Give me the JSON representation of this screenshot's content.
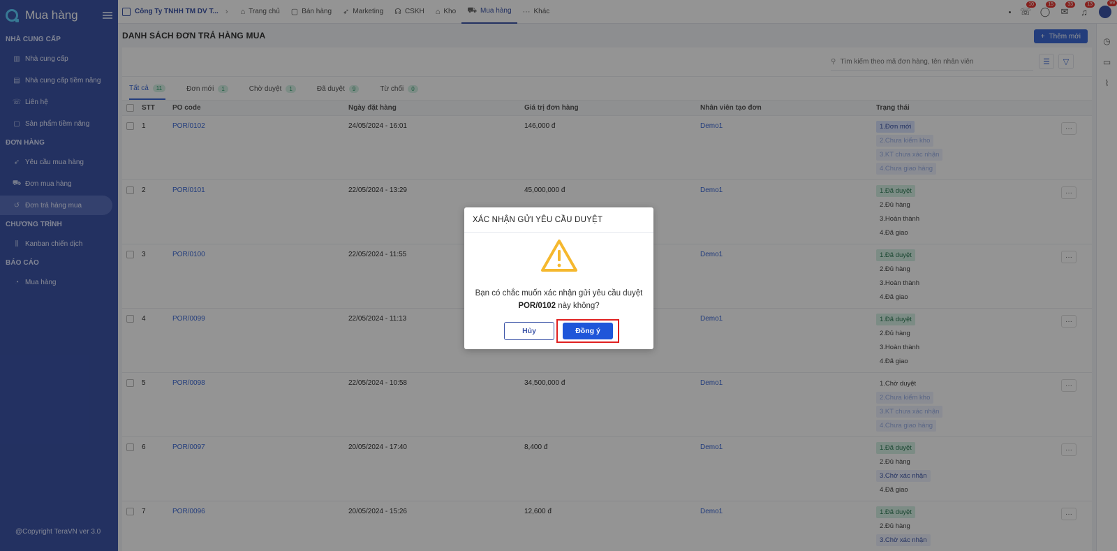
{
  "app": {
    "title": "Mua hàng",
    "copyright": "@Copyright TeraVN ver 3.0"
  },
  "sidebar": {
    "sections": [
      {
        "label": "NHÀ CUNG CẤP",
        "items": [
          {
            "label": "Nhà cung cấp",
            "icon": "building-icon"
          },
          {
            "label": "Nhà cung cấp tiềm năng",
            "icon": "buildings-icon"
          },
          {
            "label": "Liên hệ",
            "icon": "phone-icon"
          },
          {
            "label": "Sản phẩm tiềm năng",
            "icon": "box-icon"
          }
        ]
      },
      {
        "label": "ĐƠN HÀNG",
        "items": [
          {
            "label": "Yêu cầu mua hàng",
            "icon": "rocket-icon"
          },
          {
            "label": "Đơn mua hàng",
            "icon": "cart-icon"
          },
          {
            "label": "Đơn trả hàng mua",
            "icon": "return-icon",
            "active": true
          }
        ]
      },
      {
        "label": "CHƯƠNG TRÌNH",
        "items": [
          {
            "label": "Kanban chiến dịch",
            "icon": "kanban-icon"
          }
        ]
      },
      {
        "label": "BÁO CÁO",
        "items": [
          {
            "label": "Mua hàng",
            "icon": "chart-icon"
          }
        ]
      }
    ]
  },
  "topbar": {
    "company": "Công Ty TNHH TM DV T...",
    "tabs": [
      {
        "label": "Trang chủ",
        "icon": "home-icon"
      },
      {
        "label": "Bán hàng",
        "icon": "box-icon"
      },
      {
        "label": "Marketing",
        "icon": "rocket-icon"
      },
      {
        "label": "CSKH",
        "icon": "headset-icon"
      },
      {
        "label": "Kho",
        "icon": "warehouse-icon"
      },
      {
        "label": "Mua hàng",
        "icon": "cart-icon",
        "active": true
      },
      {
        "label": "Khác",
        "icon": "more-icon"
      }
    ],
    "badges": {
      "phone": "10",
      "chat": "15",
      "mail": "33",
      "bell": "13",
      "avatar": "99"
    }
  },
  "page": {
    "title": "DANH SÁCH ĐƠN TRẢ HÀNG MUA",
    "add_label": "Thêm mới",
    "search_placeholder": "Tìm kiếm theo mã đơn hàng, tên nhân viên"
  },
  "tabs": [
    {
      "label": "Tất cả",
      "count": "11",
      "active": true
    },
    {
      "label": "Đơn mới",
      "count": "1"
    },
    {
      "label": "Chờ duyệt",
      "count": "1"
    },
    {
      "label": "Đã duyệt",
      "count": "9"
    },
    {
      "label": "Từ chối",
      "count": "0"
    }
  ],
  "table": {
    "headers": {
      "stt": "STT",
      "po": "PO code",
      "date": "Ngày đặt hàng",
      "value": "Giá trị đơn hàng",
      "employee": "Nhân viên tạo đơn",
      "status": "Trạng thái"
    },
    "rows": [
      {
        "stt": "1",
        "po": "POR/0102",
        "date": "24/05/2024 - 16:01",
        "value": "146,000 đ",
        "employee": "Demo1",
        "statuses": [
          {
            "t": "1.Đơn mới",
            "k": "blue"
          },
          {
            "t": "2.Chưa kiểm kho",
            "k": "faded"
          },
          {
            "t": "3.KT chưa xác nhận",
            "k": "faded"
          },
          {
            "t": "4.Chưa giao hàng",
            "k": "faded"
          }
        ]
      },
      {
        "stt": "2",
        "po": "POR/0101",
        "date": "22/05/2024 - 13:29",
        "value": "45,000,000 đ",
        "employee": "Demo1",
        "statuses": [
          {
            "t": "1.Đã duyệt",
            "k": "green"
          },
          {
            "t": "2.Đủ hàng",
            "k": "plain"
          },
          {
            "t": "3.Hoàn thành",
            "k": "plain"
          },
          {
            "t": "4.Đã giao",
            "k": "plain"
          }
        ]
      },
      {
        "stt": "3",
        "po": "POR/0100",
        "date": "22/05/2024 - 11:55",
        "value": "",
        "employee": "Demo1",
        "statuses": [
          {
            "t": "1.Đã duyệt",
            "k": "green"
          },
          {
            "t": "2.Đủ hàng",
            "k": "plain"
          },
          {
            "t": "3.Hoàn thành",
            "k": "plain"
          },
          {
            "t": "4.Đã giao",
            "k": "plain"
          }
        ]
      },
      {
        "stt": "4",
        "po": "POR/0099",
        "date": "22/05/2024 - 11:13",
        "value": "",
        "employee": "Demo1",
        "statuses": [
          {
            "t": "1.Đã duyệt",
            "k": "green"
          },
          {
            "t": "2.Đủ hàng",
            "k": "plain"
          },
          {
            "t": "3.Hoàn thành",
            "k": "plain"
          },
          {
            "t": "4.Đã giao",
            "k": "plain"
          }
        ]
      },
      {
        "stt": "5",
        "po": "POR/0098",
        "date": "22/05/2024 - 10:58",
        "value": "34,500,000 đ",
        "employee": "Demo1",
        "statuses": [
          {
            "t": "1.Chờ duyệt",
            "k": "plain"
          },
          {
            "t": "2.Chưa kiểm kho",
            "k": "faded"
          },
          {
            "t": "3.KT chưa xác nhận",
            "k": "faded"
          },
          {
            "t": "4.Chưa giao hàng",
            "k": "faded"
          }
        ]
      },
      {
        "stt": "6",
        "po": "POR/0097",
        "date": "20/05/2024 - 17:40",
        "value": "8,400 đ",
        "employee": "Demo1",
        "statuses": [
          {
            "t": "1.Đã duyệt",
            "k": "green"
          },
          {
            "t": "2.Đủ hàng",
            "k": "plain"
          },
          {
            "t": "3.Chờ xác nhận",
            "k": "bluetext"
          },
          {
            "t": "4.Đã giao",
            "k": "plain"
          }
        ]
      },
      {
        "stt": "7",
        "po": "POR/0096",
        "date": "20/05/2024 - 15:26",
        "value": "12,600 đ",
        "employee": "Demo1",
        "statuses": [
          {
            "t": "1.Đã duyệt",
            "k": "green"
          },
          {
            "t": "2.Đủ hàng",
            "k": "plain"
          },
          {
            "t": "3.Chờ xác nhận",
            "k": "bluetext"
          }
        ]
      }
    ]
  },
  "modal": {
    "title": "XÁC NHẬN GỬI YÊU CẦU DUYỆT",
    "message_before": "Bạn có chắc muốn xác nhận gửi yêu cầu duyệt",
    "po_code": "POR/0102",
    "message_after": " này không?",
    "cancel_label": "Hủy",
    "ok_label": "Đồng ý",
    "warning_color": "#f5b82e",
    "highlight_color": "#e02020"
  }
}
